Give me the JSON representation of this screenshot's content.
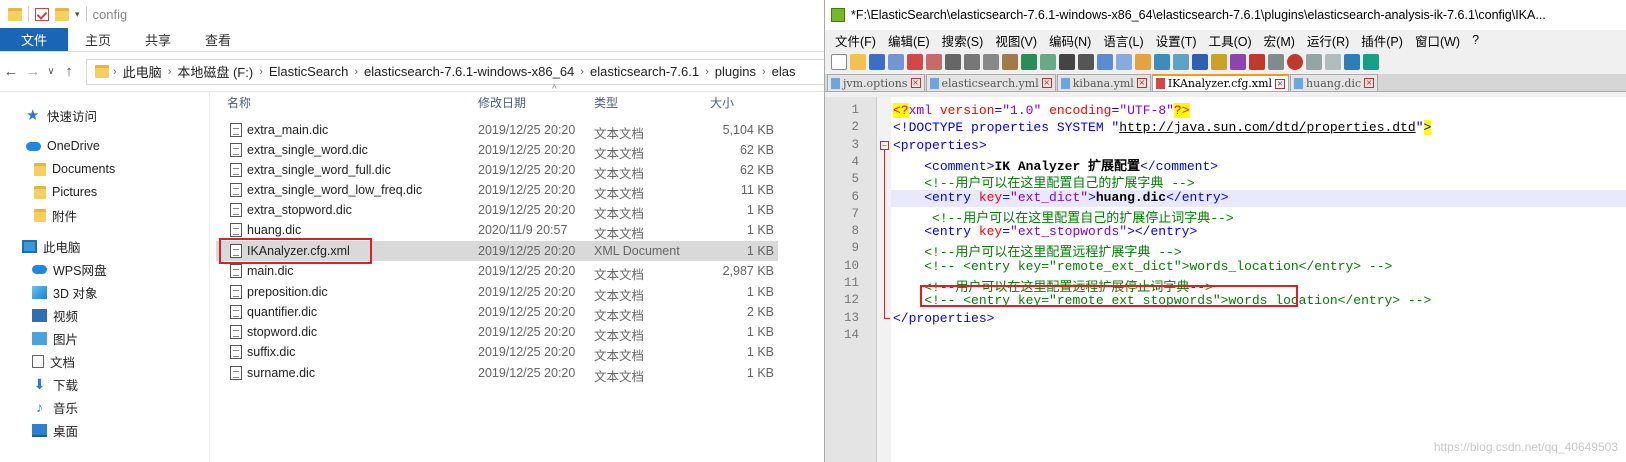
{
  "explorer": {
    "title": "config",
    "ribbon_tabs": [
      "文件",
      "主页",
      "共享",
      "查看"
    ],
    "breadcrumb": [
      "此电脑",
      "本地磁盘 (F:)",
      "ElasticSearch",
      "elasticsearch-7.6.1-windows-x86_64",
      "elasticsearch-7.6.1",
      "plugins",
      "elas"
    ],
    "nav_items": [
      {
        "label": "快速访问",
        "icon": "star-icon"
      },
      {
        "label": "OneDrive",
        "icon": "cloud-icon"
      },
      {
        "label": "Documents",
        "icon": "folder-icon"
      },
      {
        "label": "Pictures",
        "icon": "folder-icon"
      },
      {
        "label": "附件",
        "icon": "folder-icon"
      },
      {
        "label": "此电脑",
        "icon": "computer-icon"
      },
      {
        "label": "WPS网盘",
        "icon": "cloud-icon"
      },
      {
        "label": "3D 对象",
        "icon": "cube-icon"
      },
      {
        "label": "视频",
        "icon": "video-icon"
      },
      {
        "label": "图片",
        "icon": "image-icon"
      },
      {
        "label": "文档",
        "icon": "document-icon"
      },
      {
        "label": "下载",
        "icon": "download-icon"
      },
      {
        "label": "音乐",
        "icon": "music-icon"
      },
      {
        "label": "桌面",
        "icon": "desktop-icon"
      }
    ],
    "columns": {
      "name": "名称",
      "date": "修改日期",
      "type": "类型",
      "size": "大小"
    },
    "files": [
      {
        "name": "extra_main.dic",
        "date": "2019/12/25 20:20",
        "type": "文本文档",
        "size": "5,104 KB"
      },
      {
        "name": "extra_single_word.dic",
        "date": "2019/12/25 20:20",
        "type": "文本文档",
        "size": "62 KB"
      },
      {
        "name": "extra_single_word_full.dic",
        "date": "2019/12/25 20:20",
        "type": "文本文档",
        "size": "62 KB"
      },
      {
        "name": "extra_single_word_low_freq.dic",
        "date": "2019/12/25 20:20",
        "type": "文本文档",
        "size": "11 KB"
      },
      {
        "name": "extra_stopword.dic",
        "date": "2019/12/25 20:20",
        "type": "文本文档",
        "size": "1 KB"
      },
      {
        "name": "huang.dic",
        "date": "2020/11/9 20:57",
        "type": "文本文档",
        "size": "1 KB"
      },
      {
        "name": "IKAnalyzer.cfg.xml",
        "date": "2019/12/25 20:20",
        "type": "XML Document",
        "size": "1 KB"
      },
      {
        "name": "main.dic",
        "date": "2019/12/25 20:20",
        "type": "文本文档",
        "size": "2,987 KB"
      },
      {
        "name": "preposition.dic",
        "date": "2019/12/25 20:20",
        "type": "文本文档",
        "size": "1 KB"
      },
      {
        "name": "quantifier.dic",
        "date": "2019/12/25 20:20",
        "type": "文本文档",
        "size": "2 KB"
      },
      {
        "name": "stopword.dic",
        "date": "2019/12/25 20:20",
        "type": "文本文档",
        "size": "1 KB"
      },
      {
        "name": "suffix.dic",
        "date": "2019/12/25 20:20",
        "type": "文本文档",
        "size": "1 KB"
      },
      {
        "name": "surname.dic",
        "date": "2019/12/25 20:20",
        "type": "文本文档",
        "size": "1 KB"
      }
    ],
    "selected_file": "IKAnalyzer.cfg.xml"
  },
  "notepad": {
    "title": "*F:\\ElasticSearch\\elasticsearch-7.6.1-windows-x86_64\\elasticsearch-7.6.1\\plugins\\elasticsearch-analysis-ik-7.6.1\\config\\IKA...",
    "menu": [
      "文件(F)",
      "编辑(E)",
      "搜索(S)",
      "视图(V)",
      "编码(N)",
      "语言(L)",
      "设置(T)",
      "工具(O)",
      "宏(M)",
      "运行(R)",
      "插件(P)",
      "窗口(W)",
      "?"
    ],
    "tabs": [
      "jvm.options",
      "elasticsearch.yml",
      "kibana.yml",
      "IKAnalyzer.cfg.xml",
      "huang.dic"
    ],
    "active_tab": "IKAnalyzer.cfg.xml",
    "lines": [
      {
        "n": "1",
        "parts": [
          [
            "t-pi",
            "<?"
          ],
          [
            "t-pur",
            "xml "
          ],
          [
            "t-red",
            "version"
          ],
          [
            "t-bl",
            "="
          ],
          [
            "t-pur",
            "\"1.0\""
          ],
          [
            "",
            " "
          ],
          [
            "t-red",
            "encoding"
          ],
          [
            "t-bl",
            "="
          ],
          [
            "t-pur",
            "\"UTF-8\""
          ],
          [
            "t-pi",
            "?>"
          ]
        ]
      },
      {
        "n": "2",
        "parts": [
          [
            "t-bl",
            "<!DOCTYPE properties SYSTEM \""
          ],
          [
            "t-url",
            "http://java.sun.com/dtd/properties.dtd"
          ],
          [
            "t-bl",
            "\""
          ],
          [
            "t-hl t-bl",
            ">"
          ]
        ]
      },
      {
        "n": "3",
        "parts": [
          [
            "t-bl",
            "<properties>"
          ]
        ]
      },
      {
        "n": "4",
        "parts": [
          [
            "",
            "    "
          ],
          [
            "t-bl",
            "<comment>"
          ],
          [
            "t-bold",
            "IK Analyzer 扩展配置"
          ],
          [
            "t-bl",
            "</comment>"
          ]
        ]
      },
      {
        "n": "5",
        "parts": [
          [
            "",
            "    "
          ],
          [
            "t-grn",
            "<!--用户可以在这里配置自己的扩展字典 -->"
          ]
        ]
      },
      {
        "n": "6",
        "parts": [
          [
            "",
            "    "
          ],
          [
            "t-bl",
            "<entry "
          ],
          [
            "t-red",
            "key"
          ],
          [
            "t-bl",
            "="
          ],
          [
            "t-pur",
            "\"ext_dict\""
          ],
          [
            "t-bl",
            ">"
          ],
          [
            "t-bold",
            "huang.dic"
          ],
          [
            "t-bl",
            "</entry>"
          ]
        ]
      },
      {
        "n": "7",
        "parts": [
          [
            "",
            "     "
          ],
          [
            "t-grn",
            "<!--用户可以在这里配置自己的扩展停止词字典-->"
          ]
        ]
      },
      {
        "n": "8",
        "parts": [
          [
            "",
            "    "
          ],
          [
            "t-bl",
            "<entry "
          ],
          [
            "t-red",
            "key"
          ],
          [
            "t-bl",
            "="
          ],
          [
            "t-pur",
            "\"ext_stopwords\""
          ],
          [
            "t-bl",
            "></entry>"
          ]
        ]
      },
      {
        "n": "9",
        "parts": [
          [
            "",
            "    "
          ],
          [
            "t-grn",
            "<!--用户可以在这里配置远程扩展字典 -->"
          ]
        ]
      },
      {
        "n": "10",
        "parts": [
          [
            "",
            "    "
          ],
          [
            "t-grn",
            "<!-- <entry key=\"remote_ext_dict\">words_location</entry> -->"
          ]
        ]
      },
      {
        "n": "11",
        "parts": [
          [
            "",
            "    "
          ],
          [
            "t-grn",
            "<!--用户可以在这里配置远程扩展停止词字典-->"
          ]
        ]
      },
      {
        "n": "12",
        "parts": [
          [
            "",
            "    "
          ],
          [
            "t-grn",
            "<!-- <entry key=\"remote_ext_stopwords\">words_location</entry> -->"
          ]
        ]
      },
      {
        "n": "13",
        "parts": [
          [
            "t-bl",
            "</properties>"
          ]
        ]
      },
      {
        "n": "14",
        "parts": []
      }
    ],
    "current_line": "6"
  },
  "watermark": "https://blog.csdn.net/qq_40649503"
}
